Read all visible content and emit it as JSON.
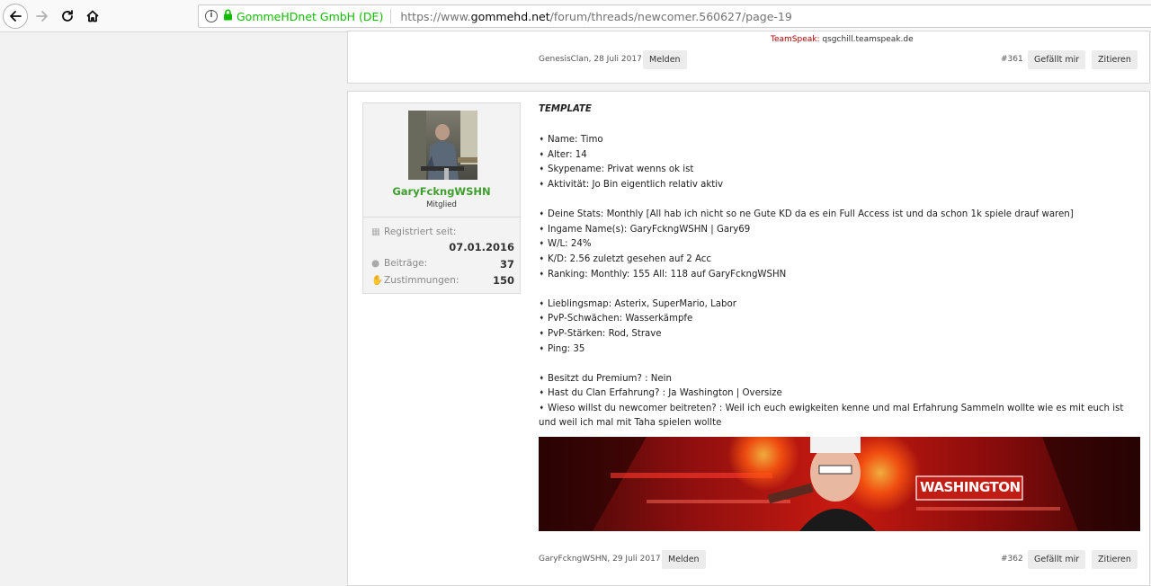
{
  "browser": {
    "org": "GommeHDnet GmbH (DE)",
    "url_prefix": "https://www.",
    "url_domain": "gommehd.net",
    "url_path": "/forum/threads/newcomer.560627/page-19"
  },
  "post1": {
    "teamspeak_label": "TeamSpeak:",
    "teamspeak_value": "qsgchill.teamspeak.de",
    "meta": "GenesisClan, 28 Juli 2017",
    "report_label": "Melden",
    "number": "#361",
    "like_label": "Gefällt mir",
    "quote_label": "Zitieren"
  },
  "post2": {
    "user": {
      "name": "GaryFckngWSHN",
      "role": "Mitglied",
      "registered_label": "Registriert seit:",
      "registered_value": "07.01.2016",
      "posts_label": "Beiträge:",
      "posts_value": "37",
      "likes_label": "Zustimmungen:",
      "likes_value": "150"
    },
    "title": "TEMPLATE",
    "lines": [
      "Name: Timo",
      "Alter: 14",
      "Skypename: Privat wenns ok ist",
      "Aktivität: Jo Bin eigentlich relativ aktiv",
      "Deine Stats: Monthly [All hab ich nicht so ne Gute KD da es ein Full Access ist und da schon 1k spiele drauf waren]",
      "Ingame Name(s): GaryFckngWSHN | Gary69",
      "W/L: 24%",
      "K/D: 2.56 zuletzt gesehen auf 2 Acc",
      "Ranking: Monthly: 155 All: 118 auf GaryFckngWSHN",
      "Lieblingsmap: Asterix, SuperMario, Labor",
      "PvP-Schwächen: Wasserkämpfe",
      "PvP-Stärken: Rod, Strave",
      "Ping: 35",
      "Besitzt du Premium? : Nein",
      "Hast du Clan Erfahrung? : Ja Washington | Oversize",
      "Wieso willst du newcomer beitreten? : Weil ich euch ewigkeiten kenne und mal Erfahrung Sammeln wollte wie es mit euch ist und weil ich mal mit Taha spielen wollte"
    ],
    "banner_text": "WASHINGTON",
    "meta": "GaryFckngWSHN, 29 Juli 2017",
    "report_label": "Melden",
    "number": "#362",
    "like_label": "Gefällt mir",
    "quote_label": "Zitieren"
  }
}
